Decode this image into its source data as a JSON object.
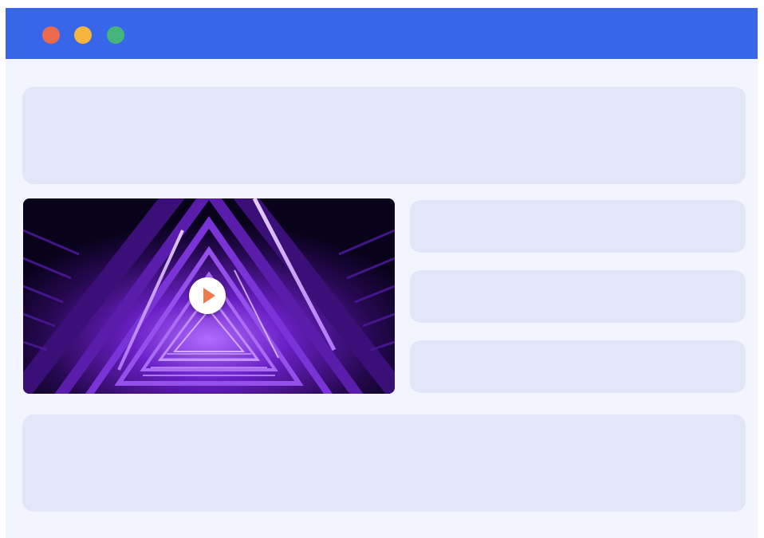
{
  "window": {
    "controls": [
      {
        "name": "close",
        "color": "#ee6a4e"
      },
      {
        "name": "minimize",
        "color": "#f8b53e"
      },
      {
        "name": "maximize",
        "color": "#46b57c"
      }
    ],
    "titlebar_color": "#3766e8",
    "background_color": "#f2f5fd"
  },
  "placeholder_color": "#e1e6f8",
  "media": {
    "kind": "video-thumbnail",
    "subject": "neon-purple-triangular-stairwell",
    "play_icon": "play-icon",
    "play_color": "#f07a4c"
  }
}
